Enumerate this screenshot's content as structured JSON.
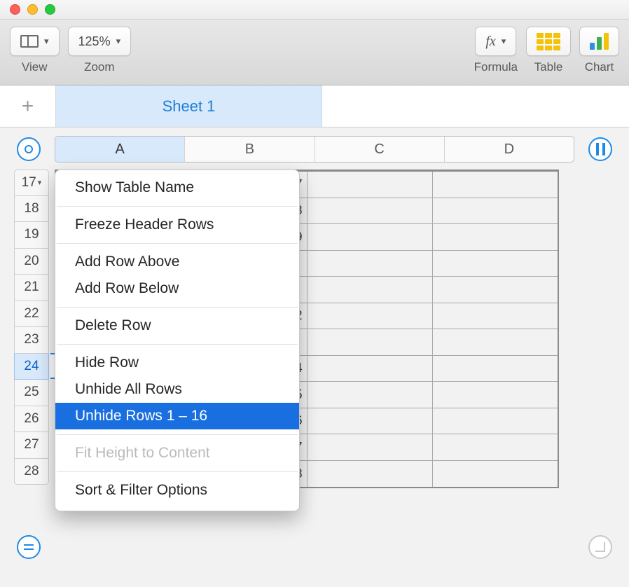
{
  "toolbar": {
    "view_label": "View",
    "zoom_value": "125%",
    "zoom_label": "Zoom",
    "formula_label": "Formula",
    "table_label": "Table",
    "chart_label": "Chart"
  },
  "sheet_tab": "Sheet 1",
  "columns": [
    "A",
    "B",
    "C",
    "D"
  ],
  "row_headers": [
    "17",
    "18",
    "19",
    "20",
    "21",
    "22",
    "23",
    "24",
    "25",
    "26",
    "27",
    "28"
  ],
  "selected_row": "24",
  "cell_values_colB": [
    "7",
    "8",
    "9",
    "",
    "",
    "2",
    "",
    "4",
    "5",
    "6",
    "7",
    "8"
  ],
  "context_menu": {
    "show_table_name": "Show Table Name",
    "freeze_header_rows": "Freeze Header Rows",
    "add_row_above": "Add Row Above",
    "add_row_below": "Add Row Below",
    "delete_row": "Delete Row",
    "hide_row": "Hide Row",
    "unhide_all": "Unhide All Rows",
    "unhide_range": "Unhide Rows 1 – 16",
    "fit_height": "Fit Height to Content",
    "sort_filter": "Sort & Filter Options"
  }
}
